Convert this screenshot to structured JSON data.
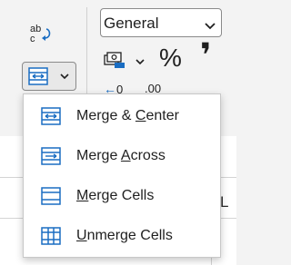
{
  "format_select": {
    "value": "General"
  },
  "number": {
    "percent_symbol": "%",
    "comma_symbol": "❜",
    "increase_decimal_label": "0",
    "decrease_decimal_label": ".00"
  },
  "grid": {
    "column_letter": "L"
  },
  "merge_menu": {
    "items": [
      {
        "label": "Merge & Center",
        "pre": "Merge & ",
        "key": "C",
        "post": "enter",
        "icon": "merge-center-icon"
      },
      {
        "label": "Merge Across",
        "pre": "Merge ",
        "key": "A",
        "post": "cross",
        "icon": "merge-across-icon"
      },
      {
        "label": "Merge Cells",
        "pre": "",
        "key": "M",
        "post": "erge Cells",
        "icon": "merge-cells-icon"
      },
      {
        "label": "Unmerge Cells",
        "pre": "",
        "key": "U",
        "post": "nmerge Cells",
        "icon": "unmerge-cells-icon"
      }
    ]
  },
  "colors": {
    "accent_blue": "#1a6dc2",
    "menu_bg": "#ffffff",
    "ribbon_bg": "#f3f3f3"
  }
}
